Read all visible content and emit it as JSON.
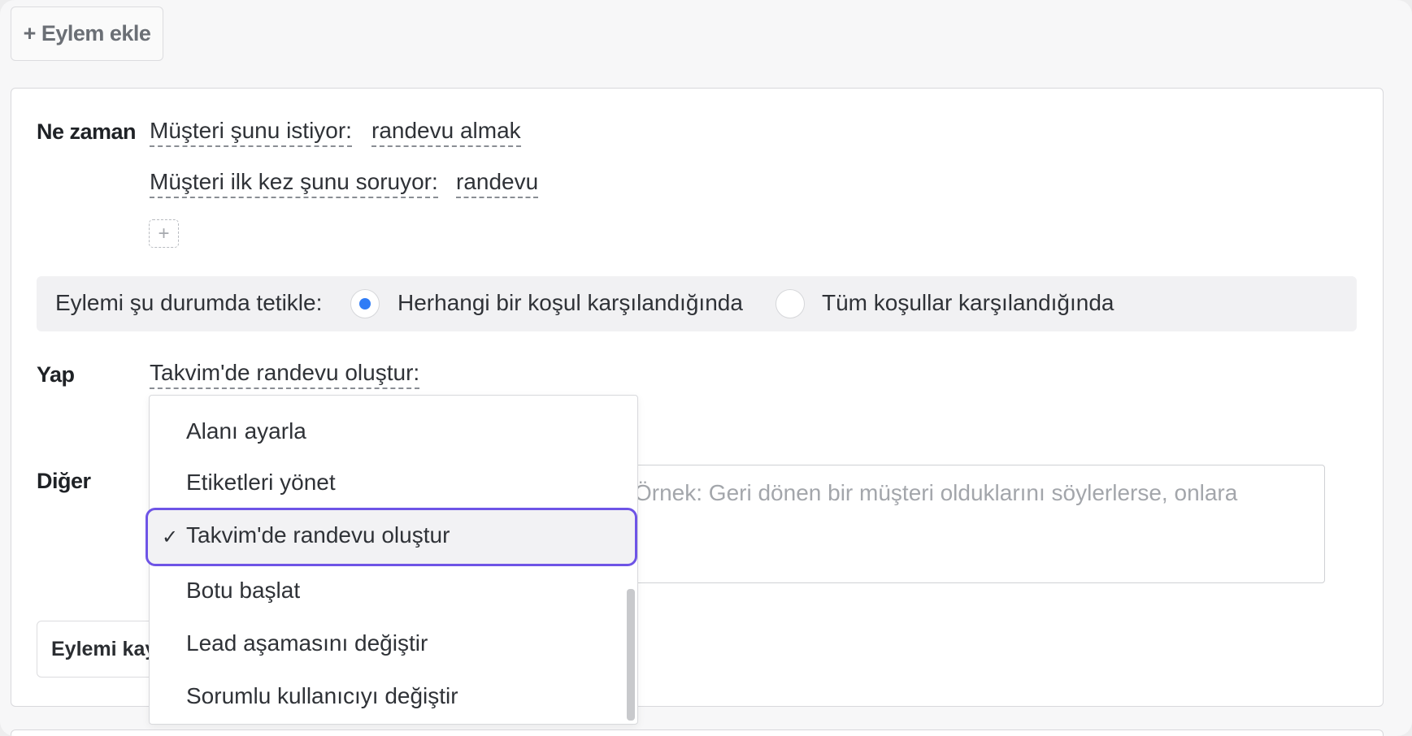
{
  "toolbar": {
    "add_action_label": "+ Eylem ekle"
  },
  "when": {
    "label": "Ne zaman",
    "conditions": [
      {
        "field": "Müşteri şunu istiyor:",
        "value": "randevu almak"
      },
      {
        "field": "Müşteri ilk kez şunu soruyor:",
        "value": "randevu"
      }
    ],
    "add_condition_label": "+"
  },
  "trigger": {
    "label": "Eylemi şu durumda tetikle:",
    "options": [
      {
        "label": "Herhangi bir koşul karşılandığında",
        "selected": true
      },
      {
        "label": "Tüm koşullar karşılandığında",
        "selected": false
      }
    ]
  },
  "do": {
    "label": "Yap",
    "action": "Takvim'de randevu oluştur:"
  },
  "other": {
    "label": "Diğer",
    "placeholder": "Örnek: Geri dönen bir müşteri olduklarını söylerlerse, onlara"
  },
  "save_button_label": "Eylemi kayd",
  "dropdown": {
    "items": [
      {
        "label": "Alanı ayarla",
        "selected": false
      },
      {
        "label": "Etiketleri yönet",
        "selected": false
      },
      {
        "label": "Takvim'de randevu oluştur",
        "selected": true
      },
      {
        "label": "Botu başlat",
        "selected": false
      },
      {
        "label": "Lead aşamasını değiştir",
        "selected": false
      },
      {
        "label": "Sorumlu kullanıcıyı değiştir",
        "selected": false
      }
    ],
    "check_glyph": "✓"
  },
  "colors": {
    "radio_selected": "#2f7cf6",
    "highlight_border": "#6e54e6"
  }
}
